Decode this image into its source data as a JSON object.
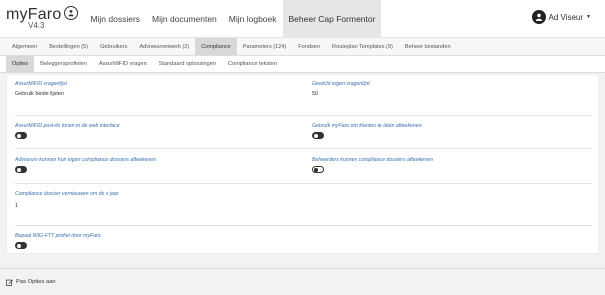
{
  "app": {
    "name": "myFaro",
    "version": "V4.3"
  },
  "nav": {
    "items": [
      {
        "label": "Mijn dossiers"
      },
      {
        "label": "Mijn documenten"
      },
      {
        "label": "Mijn logboek"
      },
      {
        "label": "Beheer Cap Formentor",
        "active": true
      }
    ]
  },
  "user": {
    "name": "Ad Viseur"
  },
  "tabs": [
    {
      "label": "Algemeen"
    },
    {
      "label": "Bestellingen (5)"
    },
    {
      "label": "Gebruikers"
    },
    {
      "label": "Adviseurnetwerk (2)"
    },
    {
      "label": "Compliance",
      "active": true
    },
    {
      "label": "Parameters (124)"
    },
    {
      "label": "Fondsen"
    },
    {
      "label": "Routeplan Templates (9)"
    },
    {
      "label": "Beheer bestanden"
    }
  ],
  "subtabs": [
    {
      "label": "Opties",
      "active": true
    },
    {
      "label": "Beleggersprofielen"
    },
    {
      "label": "AssurMiFID vragen"
    },
    {
      "label": "Standaard oplossingen"
    },
    {
      "label": "Compliance teksten"
    }
  ],
  "options": {
    "assur_label": "AssurMiFID vragenlijst",
    "assur_value": "Gebruik beide lijsten",
    "gewicht_label": "Gewicht eigen vragenlijst",
    "gewicht_value": "50",
    "postits_label": "AssurMiFID post-its tonen in de web interface",
    "postits_on": true,
    "klanten_label": "Gebruik myFaro om klanten te laten afteekenen",
    "klanten_on": true,
    "adviseurs_label": "Adviseurs kunnen hun eigen compliance dossiers afteekenen",
    "adviseurs_on": true,
    "beheerders_label": "Beheerders kunnen compliance dossiers afteekenen",
    "beheerders_on": false,
    "vernieuwen_label": "Compliance dossier vernieuwen om de x jaar",
    "vernieuwen_value": "1",
    "wig_label": "Bepaal WIG-FTT profiel door myFaro",
    "wig_on": true
  },
  "footer": {
    "action_label": "Pas Opties aan"
  },
  "colors": {
    "accent": "#3a6fb0",
    "toggle_on": "#333333",
    "active_tab": "#d8d8d8"
  },
  "icons": {
    "logo_badge": "person-circle-icon",
    "avatar": "user-avatar-icon",
    "caret": "caret-down-icon",
    "edit": "edit-icon"
  }
}
